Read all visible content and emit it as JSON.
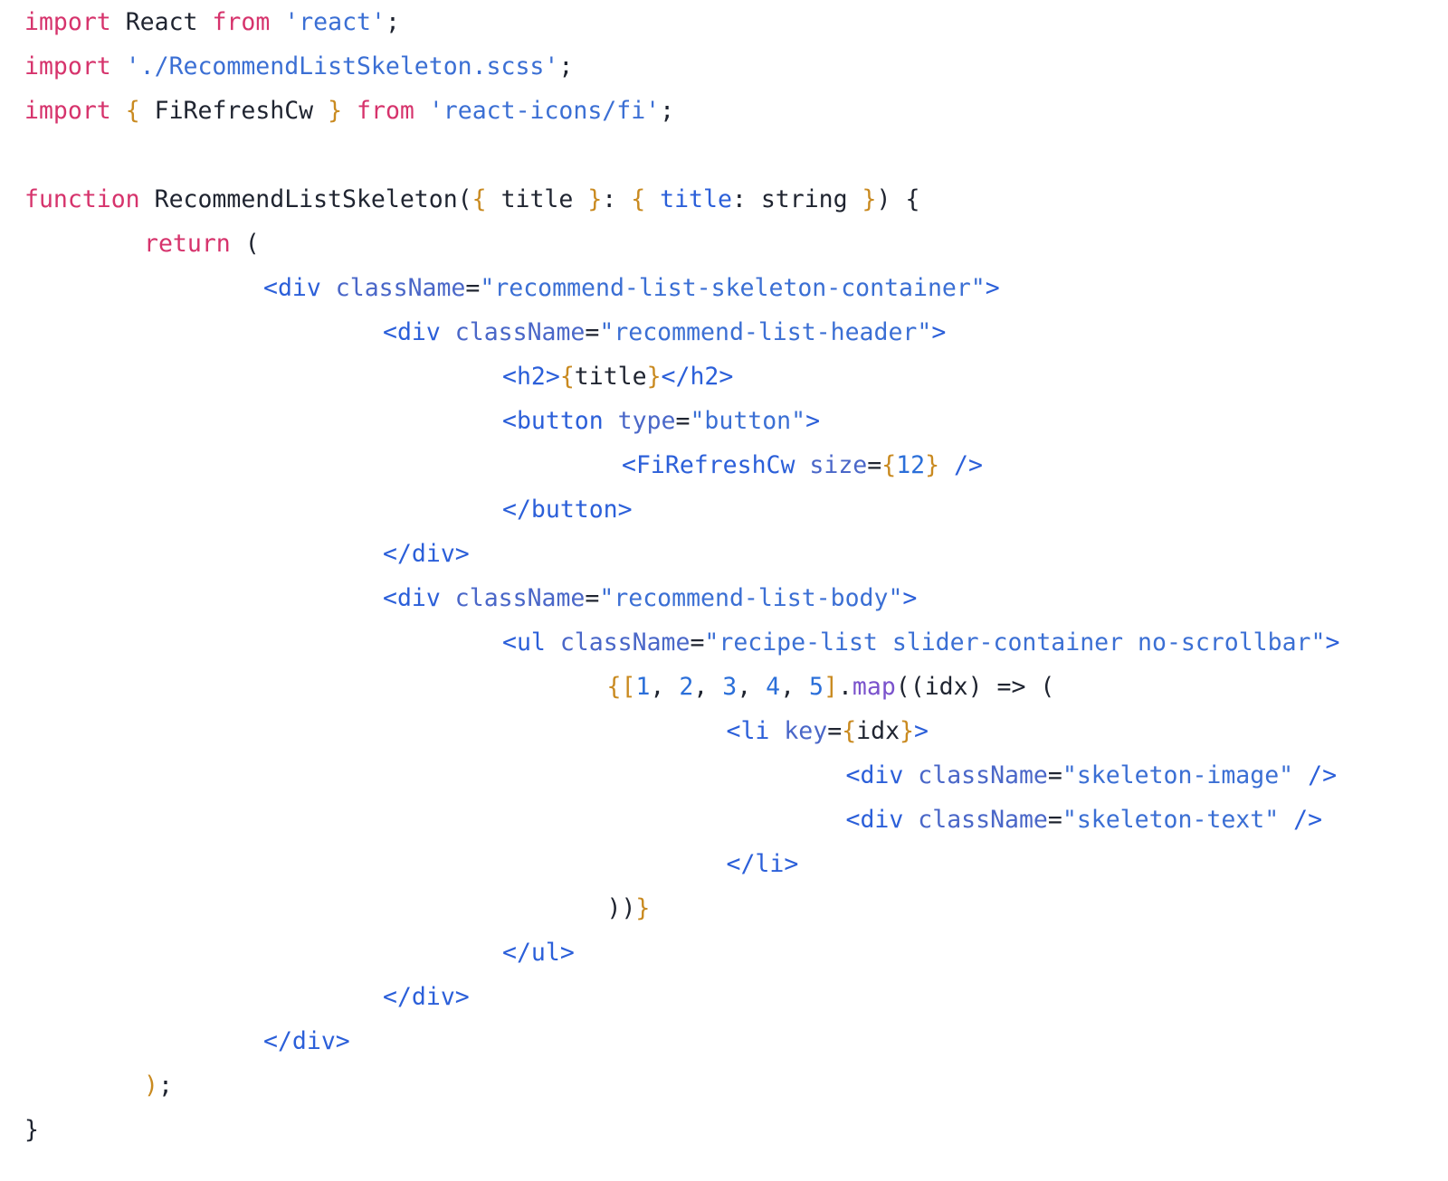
{
  "editor": {
    "language": "tsx",
    "filename_hint": "RecommendListSkeleton",
    "background_color": "#ffffff",
    "indent_unit_spaces": 8,
    "font_size_px": 26.5,
    "line_height_px": 49
  },
  "palette": {
    "keyword": "#d6336c",
    "string": "#3b6fd4",
    "tag": "#2b5fd9",
    "attribute": "#4a67c8",
    "plain": "#1f2430",
    "number": "#2b6fd9",
    "method": "#7a52cc",
    "bracket": "#c98a20"
  },
  "code": {
    "lines": [
      {
        "n": 1,
        "indent": 0,
        "text": "import React from 'react';",
        "tokens": [
          {
            "t": "import",
            "c": "k"
          },
          {
            "t": " ",
            "c": "plain"
          },
          {
            "t": "React",
            "c": "plain"
          },
          {
            "t": " ",
            "c": "plain"
          },
          {
            "t": "from",
            "c": "k"
          },
          {
            "t": " ",
            "c": "plain"
          },
          {
            "t": "'react'",
            "c": "str"
          },
          {
            "t": ";",
            "c": "plain"
          }
        ]
      },
      {
        "n": 2,
        "indent": 0,
        "text": "import './RecommendListSkeleton.scss';",
        "tokens": [
          {
            "t": "import",
            "c": "k"
          },
          {
            "t": " ",
            "c": "plain"
          },
          {
            "t": "'./RecommendListSkeleton.scss'",
            "c": "str"
          },
          {
            "t": ";",
            "c": "plain"
          }
        ]
      },
      {
        "n": 3,
        "indent": 0,
        "text": "import { FiRefreshCw } from 'react-icons/fi';",
        "tokens": [
          {
            "t": "import",
            "c": "k"
          },
          {
            "t": " ",
            "c": "plain"
          },
          {
            "t": "{",
            "c": "br"
          },
          {
            "t": " ",
            "c": "plain"
          },
          {
            "t": "FiRefreshCw",
            "c": "plain"
          },
          {
            "t": " ",
            "c": "plain"
          },
          {
            "t": "}",
            "c": "br"
          },
          {
            "t": " ",
            "c": "plain"
          },
          {
            "t": "from",
            "c": "k"
          },
          {
            "t": " ",
            "c": "plain"
          },
          {
            "t": "'react-icons/fi'",
            "c": "str"
          },
          {
            "t": ";",
            "c": "plain"
          }
        ]
      },
      {
        "n": 4,
        "indent": 0,
        "text": "",
        "tokens": []
      },
      {
        "n": 5,
        "indent": 0,
        "text": "function RecommendListSkeleton({ title }: { title: string }) {",
        "tokens": [
          {
            "t": "function",
            "c": "k"
          },
          {
            "t": " ",
            "c": "plain"
          },
          {
            "t": "RecommendListSkeleton",
            "c": "plain"
          },
          {
            "t": "(",
            "c": "plain"
          },
          {
            "t": "{",
            "c": "br"
          },
          {
            "t": " ",
            "c": "plain"
          },
          {
            "t": "title",
            "c": "plain"
          },
          {
            "t": " ",
            "c": "plain"
          },
          {
            "t": "}",
            "c": "br"
          },
          {
            "t": ": ",
            "c": "plain"
          },
          {
            "t": "{",
            "c": "br"
          },
          {
            "t": " ",
            "c": "plain"
          },
          {
            "t": "title",
            "c": "type"
          },
          {
            "t": ": ",
            "c": "plain"
          },
          {
            "t": "string",
            "c": "plain"
          },
          {
            "t": " ",
            "c": "plain"
          },
          {
            "t": "}",
            "c": "br"
          },
          {
            "t": ")",
            "c": "plain"
          },
          {
            "t": " ",
            "c": "plain"
          },
          {
            "t": "{",
            "c": "plain"
          }
        ]
      },
      {
        "n": 6,
        "indent": 8,
        "text": "return (",
        "tokens": [
          {
            "t": "return",
            "c": "k"
          },
          {
            "t": " ",
            "c": "plain"
          },
          {
            "t": "(",
            "c": "plain"
          }
        ]
      },
      {
        "n": 7,
        "indent": 16,
        "text": "<div className=\"recommend-list-skeleton-container\">",
        "tokens": [
          {
            "t": "<div",
            "c": "tag"
          },
          {
            "t": " ",
            "c": "plain"
          },
          {
            "t": "className",
            "c": "attr"
          },
          {
            "t": "=",
            "c": "plain"
          },
          {
            "t": "\"recommend-list-skeleton-container\"",
            "c": "str"
          },
          {
            "t": ">",
            "c": "tag"
          }
        ]
      },
      {
        "n": 8,
        "indent": 24,
        "text": "<div className=\"recommend-list-header\">",
        "tokens": [
          {
            "t": "<div",
            "c": "tag"
          },
          {
            "t": " ",
            "c": "plain"
          },
          {
            "t": "className",
            "c": "attr"
          },
          {
            "t": "=",
            "c": "plain"
          },
          {
            "t": "\"recommend-list-header\"",
            "c": "str"
          },
          {
            "t": ">",
            "c": "tag"
          }
        ]
      },
      {
        "n": 9,
        "indent": 32,
        "text": "<h2>{title}</h2>",
        "tokens": [
          {
            "t": "<h2>",
            "c": "tag"
          },
          {
            "t": "{",
            "c": "br"
          },
          {
            "t": "title",
            "c": "plain"
          },
          {
            "t": "}",
            "c": "br"
          },
          {
            "t": "</h2>",
            "c": "tag"
          }
        ]
      },
      {
        "n": 10,
        "indent": 32,
        "text": "<button type=\"button\">",
        "tokens": [
          {
            "t": "<button",
            "c": "tag"
          },
          {
            "t": " ",
            "c": "plain"
          },
          {
            "t": "type",
            "c": "attr"
          },
          {
            "t": "=",
            "c": "plain"
          },
          {
            "t": "\"button\"",
            "c": "str"
          },
          {
            "t": ">",
            "c": "tag"
          }
        ]
      },
      {
        "n": 11,
        "indent": 40,
        "text": "<FiRefreshCw size={12} />",
        "tokens": [
          {
            "t": "<FiRefreshCw",
            "c": "comp"
          },
          {
            "t": " ",
            "c": "plain"
          },
          {
            "t": "size",
            "c": "attr"
          },
          {
            "t": "=",
            "c": "plain"
          },
          {
            "t": "{",
            "c": "br"
          },
          {
            "t": "12",
            "c": "num"
          },
          {
            "t": "}",
            "c": "br"
          },
          {
            "t": " ",
            "c": "plain"
          },
          {
            "t": "/>",
            "c": "tag"
          }
        ]
      },
      {
        "n": 12,
        "indent": 32,
        "text": "</button>",
        "tokens": [
          {
            "t": "</button>",
            "c": "tag"
          }
        ]
      },
      {
        "n": 13,
        "indent": 24,
        "text": "</div>",
        "tokens": [
          {
            "t": "</div>",
            "c": "tag"
          }
        ]
      },
      {
        "n": 14,
        "indent": 24,
        "text": "<div className=\"recommend-list-body\">",
        "tokens": [
          {
            "t": "<div",
            "c": "tag"
          },
          {
            "t": " ",
            "c": "plain"
          },
          {
            "t": "className",
            "c": "attr"
          },
          {
            "t": "=",
            "c": "plain"
          },
          {
            "t": "\"recommend-list-body\"",
            "c": "str"
          },
          {
            "t": ">",
            "c": "tag"
          }
        ]
      },
      {
        "n": 15,
        "indent": 32,
        "text": "<ul className=\"recipe-list slider-container no-scrollbar\">",
        "tokens": [
          {
            "t": "<ul",
            "c": "tag"
          },
          {
            "t": " ",
            "c": "plain"
          },
          {
            "t": "className",
            "c": "attr"
          },
          {
            "t": "=",
            "c": "plain"
          },
          {
            "t": "\"recipe-list slider-container no-scrollbar\"",
            "c": "str"
          },
          {
            "t": ">",
            "c": "tag"
          }
        ]
      },
      {
        "n": 16,
        "indent": 39,
        "text": "{[1, 2, 3, 4, 5].map((idx) => (",
        "tokens": [
          {
            "t": "{",
            "c": "br"
          },
          {
            "t": "[",
            "c": "br"
          },
          {
            "t": "1",
            "c": "num"
          },
          {
            "t": ", ",
            "c": "plain"
          },
          {
            "t": "2",
            "c": "num"
          },
          {
            "t": ", ",
            "c": "plain"
          },
          {
            "t": "3",
            "c": "num"
          },
          {
            "t": ", ",
            "c": "plain"
          },
          {
            "t": "4",
            "c": "num"
          },
          {
            "t": ", ",
            "c": "plain"
          },
          {
            "t": "5",
            "c": "num"
          },
          {
            "t": "]",
            "c": "br"
          },
          {
            "t": ".",
            "c": "plain"
          },
          {
            "t": "map",
            "c": "fn"
          },
          {
            "t": "((",
            "c": "plain"
          },
          {
            "t": "idx",
            "c": "plain"
          },
          {
            "t": ")",
            "c": "plain"
          },
          {
            "t": " ",
            "c": "plain"
          },
          {
            "t": "=>",
            "c": "op"
          },
          {
            "t": " ",
            "c": "plain"
          },
          {
            "t": "(",
            "c": "plain"
          }
        ]
      },
      {
        "n": 17,
        "indent": 47,
        "text": "<li key={idx}>",
        "tokens": [
          {
            "t": "<li",
            "c": "tag"
          },
          {
            "t": " ",
            "c": "plain"
          },
          {
            "t": "key",
            "c": "attr"
          },
          {
            "t": "=",
            "c": "plain"
          },
          {
            "t": "{",
            "c": "br"
          },
          {
            "t": "idx",
            "c": "plain"
          },
          {
            "t": "}",
            "c": "br"
          },
          {
            "t": ">",
            "c": "tag"
          }
        ]
      },
      {
        "n": 18,
        "indent": 55,
        "text": "<div className=\"skeleton-image\" />",
        "tokens": [
          {
            "t": "<div",
            "c": "tag"
          },
          {
            "t": " ",
            "c": "plain"
          },
          {
            "t": "className",
            "c": "attr"
          },
          {
            "t": "=",
            "c": "plain"
          },
          {
            "t": "\"skeleton-image\"",
            "c": "str"
          },
          {
            "t": " ",
            "c": "plain"
          },
          {
            "t": "/>",
            "c": "tag"
          }
        ]
      },
      {
        "n": 19,
        "indent": 55,
        "text": "<div className=\"skeleton-text\" />",
        "tokens": [
          {
            "t": "<div",
            "c": "tag"
          },
          {
            "t": " ",
            "c": "plain"
          },
          {
            "t": "className",
            "c": "attr"
          },
          {
            "t": "=",
            "c": "plain"
          },
          {
            "t": "\"skeleton-text\"",
            "c": "str"
          },
          {
            "t": " ",
            "c": "plain"
          },
          {
            "t": "/>",
            "c": "tag"
          }
        ]
      },
      {
        "n": 20,
        "indent": 47,
        "text": "</li>",
        "tokens": [
          {
            "t": "</li>",
            "c": "tag"
          }
        ]
      },
      {
        "n": 21,
        "indent": 39,
        "text": "))}",
        "tokens": [
          {
            "t": "))",
            "c": "plain"
          },
          {
            "t": "}",
            "c": "br"
          }
        ]
      },
      {
        "n": 22,
        "indent": 32,
        "text": "</ul>",
        "tokens": [
          {
            "t": "</ul>",
            "c": "tag"
          }
        ]
      },
      {
        "n": 23,
        "indent": 24,
        "text": "</div>",
        "tokens": [
          {
            "t": "</div>",
            "c": "tag"
          }
        ]
      },
      {
        "n": 24,
        "indent": 16,
        "text": "</div>",
        "tokens": [
          {
            "t": "</div>",
            "c": "tag"
          }
        ]
      },
      {
        "n": 25,
        "indent": 8,
        "text": ");",
        "tokens": [
          {
            "t": ")",
            "c": "br"
          },
          {
            "t": ";",
            "c": "plain"
          }
        ]
      },
      {
        "n": 26,
        "indent": 0,
        "text": "}",
        "tokens": [
          {
            "t": "}",
            "c": "plain"
          }
        ]
      }
    ]
  }
}
